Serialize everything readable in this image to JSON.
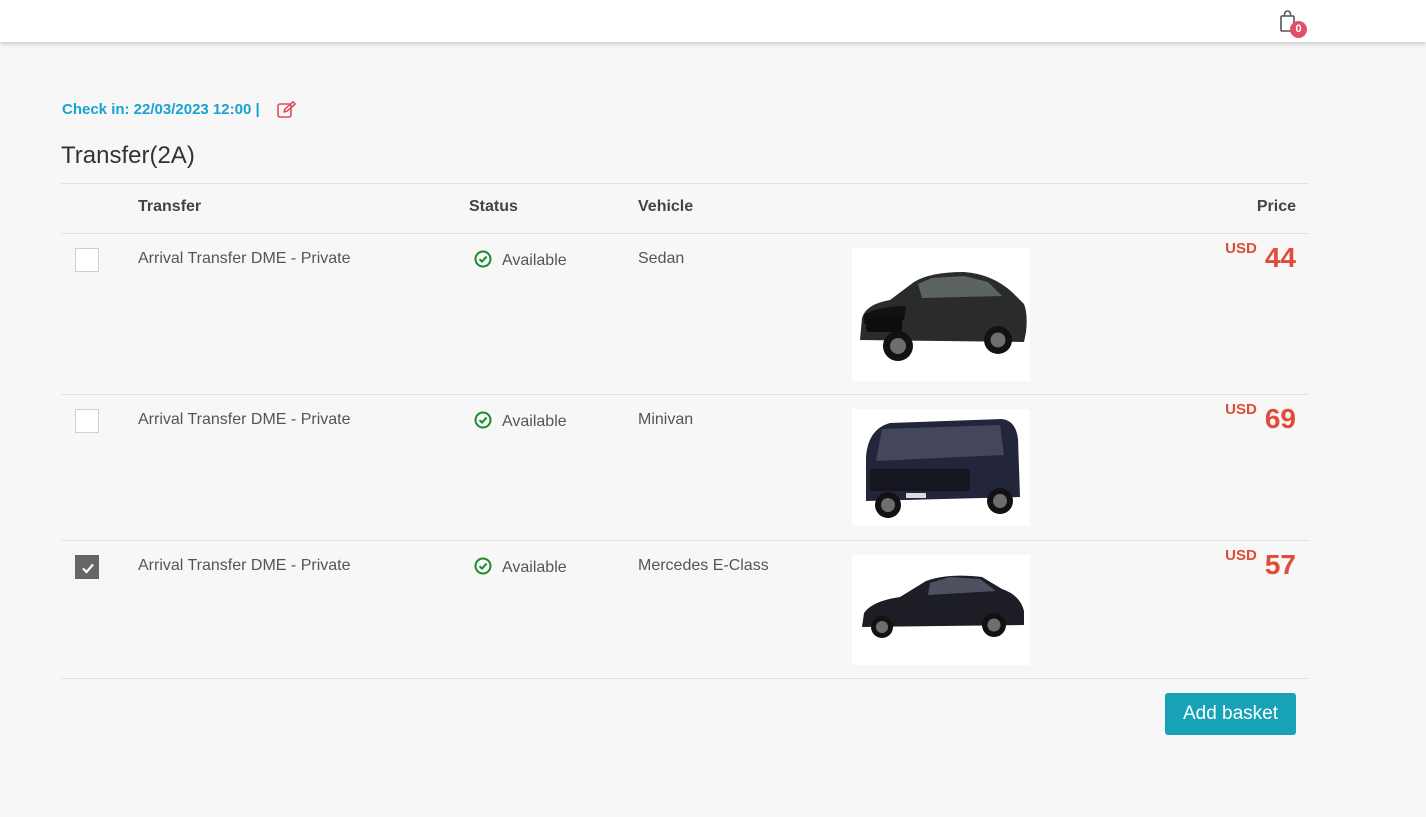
{
  "header": {
    "basket_icon": "shopping-bag-icon",
    "basket_count": "0"
  },
  "checkin": {
    "label": "Check in: 22/03/2023 12:00 |",
    "edit_icon": "edit-icon"
  },
  "section": {
    "title": "Transfer(2A)"
  },
  "table": {
    "columns": {
      "transfer": "Transfer",
      "status": "Status",
      "vehicle": "Vehicle",
      "price": "Price"
    },
    "rows": [
      {
        "checked": false,
        "transfer": "Arrival Transfer DME - Private",
        "status": "Available",
        "vehicle": "Sedan",
        "currency": "USD",
        "price": "44"
      },
      {
        "checked": false,
        "transfer": "Arrival Transfer DME - Private",
        "status": "Available",
        "vehicle": "Minivan",
        "currency": "USD",
        "price": "69"
      },
      {
        "checked": true,
        "transfer": "Arrival Transfer DME - Private",
        "status": "Available",
        "vehicle": "Mercedes E-Class",
        "currency": "USD",
        "price": "57"
      }
    ]
  },
  "actions": {
    "add_basket": "Add basket"
  },
  "colors": {
    "accent": "#17a2cf",
    "button": "#17a2b8",
    "price": "#e04b3a",
    "available": "#1a8a2e",
    "badge": "#e0506a"
  }
}
